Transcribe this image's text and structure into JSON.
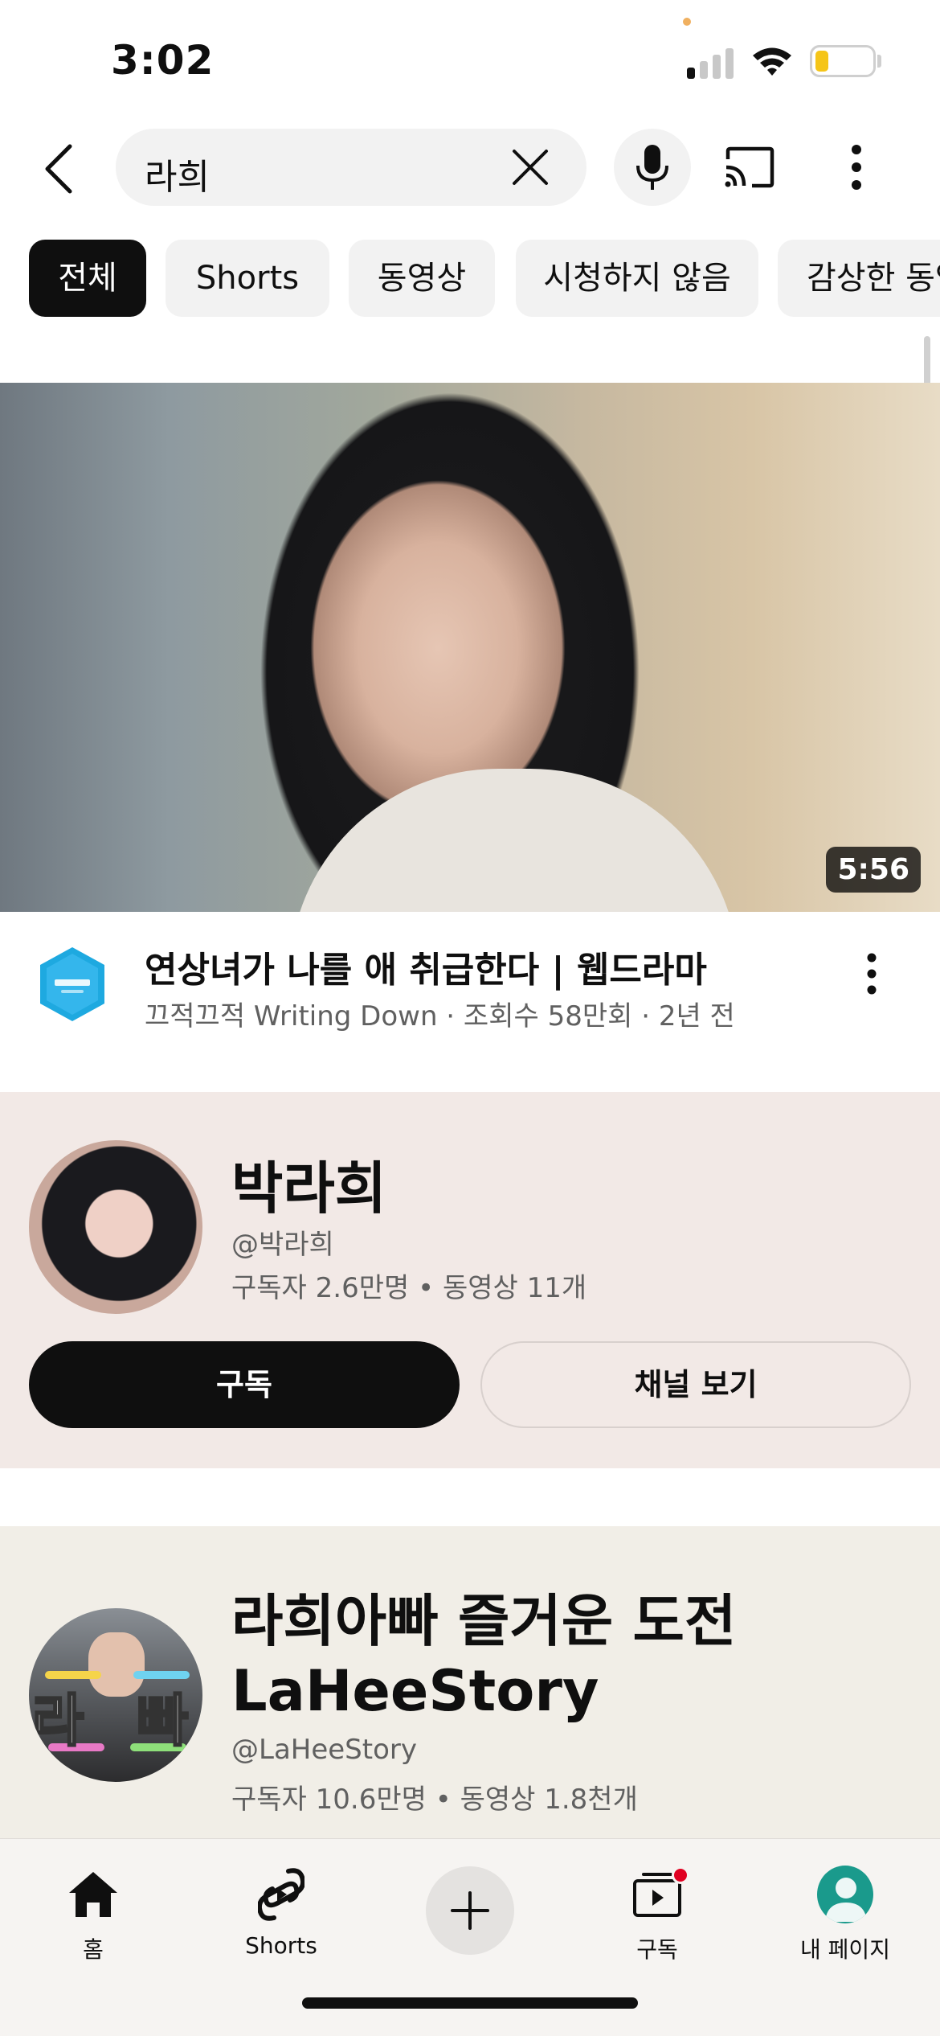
{
  "status_bar": {
    "time": "3:02"
  },
  "search": {
    "query": "라희"
  },
  "chips": [
    "전체",
    "Shorts",
    "동영상",
    "시청하지 않음",
    "감상한 동영상"
  ],
  "video": {
    "duration": "5:56",
    "title": "연상녀가 나를 애 취급한다 | 웹드라마",
    "meta": "끄적끄적 Writing Down · 조회수 58만회 · 2년 전"
  },
  "channels": [
    {
      "name": "박라희",
      "handle": "@박라희",
      "stats": "구독자 2.6만명 • 동영상 11개",
      "subscribe_label": "구독",
      "view_channel_label": "채널 보기"
    },
    {
      "name_line1": "라희아빠 즐거운 도전",
      "name_line2": "LaHeeStory",
      "handle": "@LaHeeStory",
      "stats": "구독자 10.6만명 • 동영상 1.8천개",
      "avatar_left_text": "라",
      "avatar_right_text": "빠"
    }
  ],
  "bottom_nav": {
    "home": "홈",
    "shorts": "Shorts",
    "subscriptions": "구독",
    "me": "내 페이지"
  },
  "colors": {
    "accent": "#0f0f0f",
    "notification": "#e00021",
    "card1_bg": "#f2e9e6",
    "card2_bg": "#f1eee7",
    "channel_logo": "#1ea9e0",
    "me_avatar": "#1a9a8c"
  },
  "icons": [
    "back-arrow-icon",
    "close-icon",
    "mic-icon",
    "cast-icon",
    "more-vert-icon",
    "home-icon",
    "shorts-icon",
    "plus-icon",
    "subscriptions-icon",
    "account-icon"
  ]
}
